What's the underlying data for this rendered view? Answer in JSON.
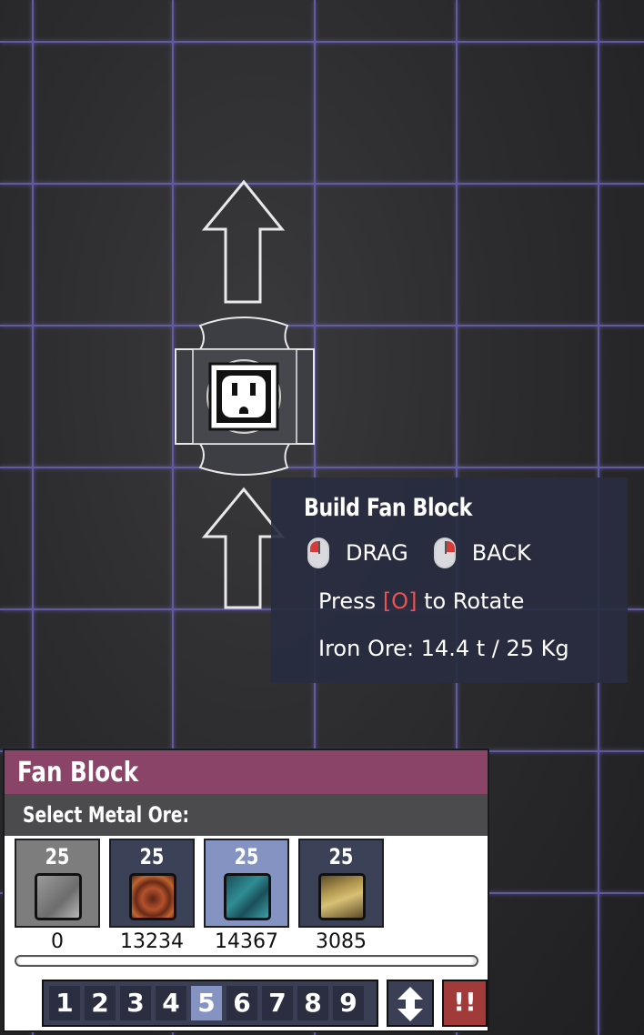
{
  "tooltip": {
    "title": "Build Fan Block",
    "drag_label": "DRAG",
    "back_label": "BACK",
    "rotate_prefix": "Press",
    "rotate_key": "[O]",
    "rotate_suffix": "to Rotate",
    "material_line": "Iron Ore: 14.4 t / 25 Kg"
  },
  "build_preview": {
    "building_icon": "power-outlet-icon",
    "flow_arrows": [
      "up-arrow-icon",
      "up-arrow-icon"
    ]
  },
  "panel": {
    "title": "Fan Block",
    "subtitle": "Select Metal Ore:",
    "ores": [
      {
        "cost": "25",
        "available": "0",
        "state": "disabled",
        "swatch_colors": [
          "#9a9a9a",
          "#6d6d6d"
        ]
      },
      {
        "cost": "25",
        "available": "13234",
        "state": "normal",
        "swatch_colors": [
          "#b3522c",
          "#5a2316"
        ]
      },
      {
        "cost": "25",
        "available": "14367",
        "state": "selected",
        "swatch_colors": [
          "#2f8d95",
          "#1b4f58"
        ]
      },
      {
        "cost": "25",
        "available": "3085",
        "state": "normal",
        "swatch_colors": [
          "#b59a52",
          "#5d4d28"
        ]
      }
    ],
    "pages": [
      "1",
      "2",
      "3",
      "4",
      "5",
      "6",
      "7",
      "8",
      "9"
    ],
    "active_page": "5",
    "sort_icon": "swap-vertical-icon",
    "alert_label": "!!"
  },
  "colors": {
    "header": "#8a4468",
    "selected": "#8493c2",
    "grid_line": "#5e5a9a",
    "key_highlight": "#f05050"
  }
}
